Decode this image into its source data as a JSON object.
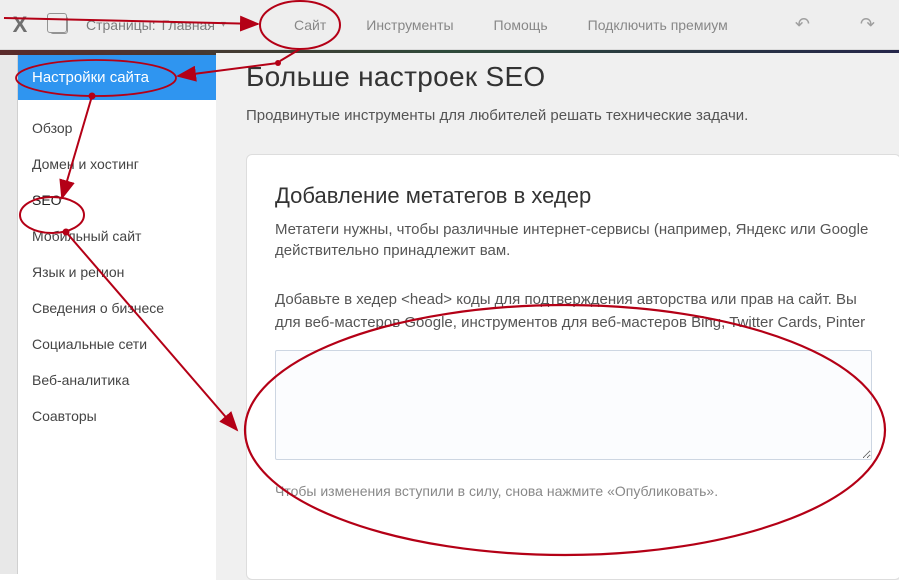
{
  "topbar": {
    "pages_label": "Страницы:",
    "current_page": "Главная",
    "menu": {
      "site": "Сайт",
      "tools": "Инструменты",
      "help": "Помощь",
      "premium": "Подключить премиум"
    }
  },
  "site_settings_header": "Настройки сайта",
  "sidebar": {
    "items": [
      {
        "label": "Обзор"
      },
      {
        "label": "Домен и хостинг"
      },
      {
        "label": "SEO"
      },
      {
        "label": "Мобильный сайт"
      },
      {
        "label": "Язык и регион"
      },
      {
        "label": "Сведения о бизнесе"
      },
      {
        "label": "Социальные сети"
      },
      {
        "label": "Веб-аналитика"
      },
      {
        "label": "Соавторы"
      }
    ]
  },
  "content": {
    "title": "Больше настроек SEO",
    "subtitle": "Продвинутые инструменты для любителей решать технические задачи.",
    "card": {
      "heading": "Добавление метатегов в хедер",
      "p1": "Метатеги нужны, чтобы различные интернет-сервисы (например, Яндекс или Google действительно принадлежит вам.",
      "p2": "Добавьте в хедер <head> коды для подтверждения авторства или прав на сайт. Вы для веб-мастеров Google, инструментов для веб-мастеров Bing, Twitter Cards, Pinter",
      "note": "Чтобы изменения вступили в силу, снова нажмите «Опубликовать»."
    }
  }
}
